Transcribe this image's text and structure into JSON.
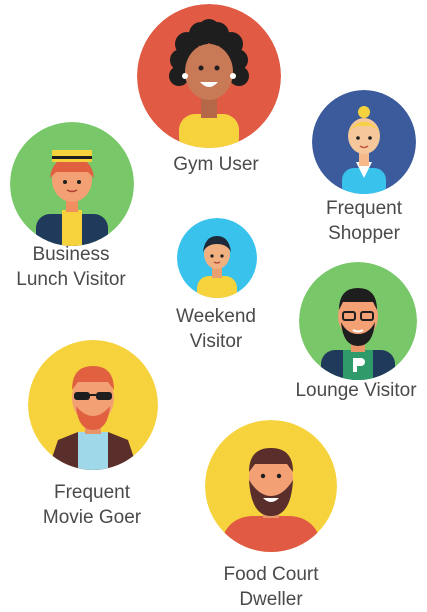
{
  "personas": [
    {
      "id": "gym-user",
      "lines": [
        "Gym User"
      ],
      "bg": "#e05a44"
    },
    {
      "id": "frequent-shopper",
      "lines": [
        "Frequent",
        "Shopper"
      ],
      "bg": "#3b5b9c"
    },
    {
      "id": "business-lunch-visitor",
      "lines": [
        "Business",
        "Lunch Visitor"
      ],
      "bg": "#78c86a"
    },
    {
      "id": "weekend-visitor",
      "lines": [
        "Weekend",
        "Visitor"
      ],
      "bg": "#38c2ec"
    },
    {
      "id": "lounge-visitor",
      "lines": [
        "Lounge Visitor"
      ],
      "bg": "#78c86a"
    },
    {
      "id": "frequent-movie-goer",
      "lines": [
        "Frequent",
        "Movie Goer"
      ],
      "bg": "#f6d23c"
    },
    {
      "id": "food-court-dweller",
      "lines": [
        "Food Court",
        "Dweller"
      ],
      "bg": "#f6d23c"
    }
  ]
}
